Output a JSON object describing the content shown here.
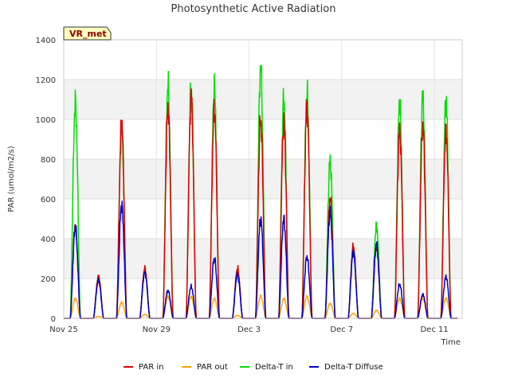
{
  "chart_data": {
    "type": "line",
    "title": "Photosynthetic Active Radiation",
    "xlabel": "Time",
    "ylabel": "PAR (umol/m2/s)",
    "site_label": "VR_met",
    "ylim": [
      0,
      1400
    ],
    "xlim": [
      0,
      17.2
    ],
    "yticks": [
      0,
      200,
      400,
      600,
      800,
      1000,
      1200,
      1400
    ],
    "xticks": [
      {
        "label": "Nov 25",
        "day": 0
      },
      {
        "label": "Nov 29",
        "day": 4
      },
      {
        "label": "Dec 3",
        "day": 8
      },
      {
        "label": "Dec 7",
        "day": 12
      },
      {
        "label": "Dec 11",
        "day": 16
      }
    ],
    "grid": true,
    "banded_background": true,
    "legend_position": "bottom",
    "series": [
      {
        "name": "PAR in",
        "color": "#dd0000",
        "daily_peaks": [
          460,
          210,
          980,
          250,
          1060,
          1120,
          1050,
          250,
          1000,
          980,
          1060,
          600,
          360,
          360,
          940,
          960,
          940
        ]
      },
      {
        "name": "PAR out",
        "color": "#ffa500",
        "daily_peaks": [
          100,
          10,
          80,
          20,
          110,
          110,
          100,
          15,
          110,
          100,
          110,
          75,
          25,
          40,
          100,
          100,
          100
        ]
      },
      {
        "name": "Delta-T in",
        "color": "#00dd00",
        "daily_peaks": [
          1080,
          200,
          950,
          240,
          1170,
          1160,
          1160,
          240,
          1260,
          1100,
          1130,
          790,
          350,
          465,
          1090,
          1115,
          1090
        ]
      },
      {
        "name": "Delta-T Diffuse",
        "color": "#0000cc",
        "daily_peaks": [
          460,
          190,
          570,
          230,
          140,
          160,
          300,
          220,
          500,
          500,
          310,
          530,
          330,
          370,
          170,
          120,
          210
        ]
      }
    ]
  }
}
